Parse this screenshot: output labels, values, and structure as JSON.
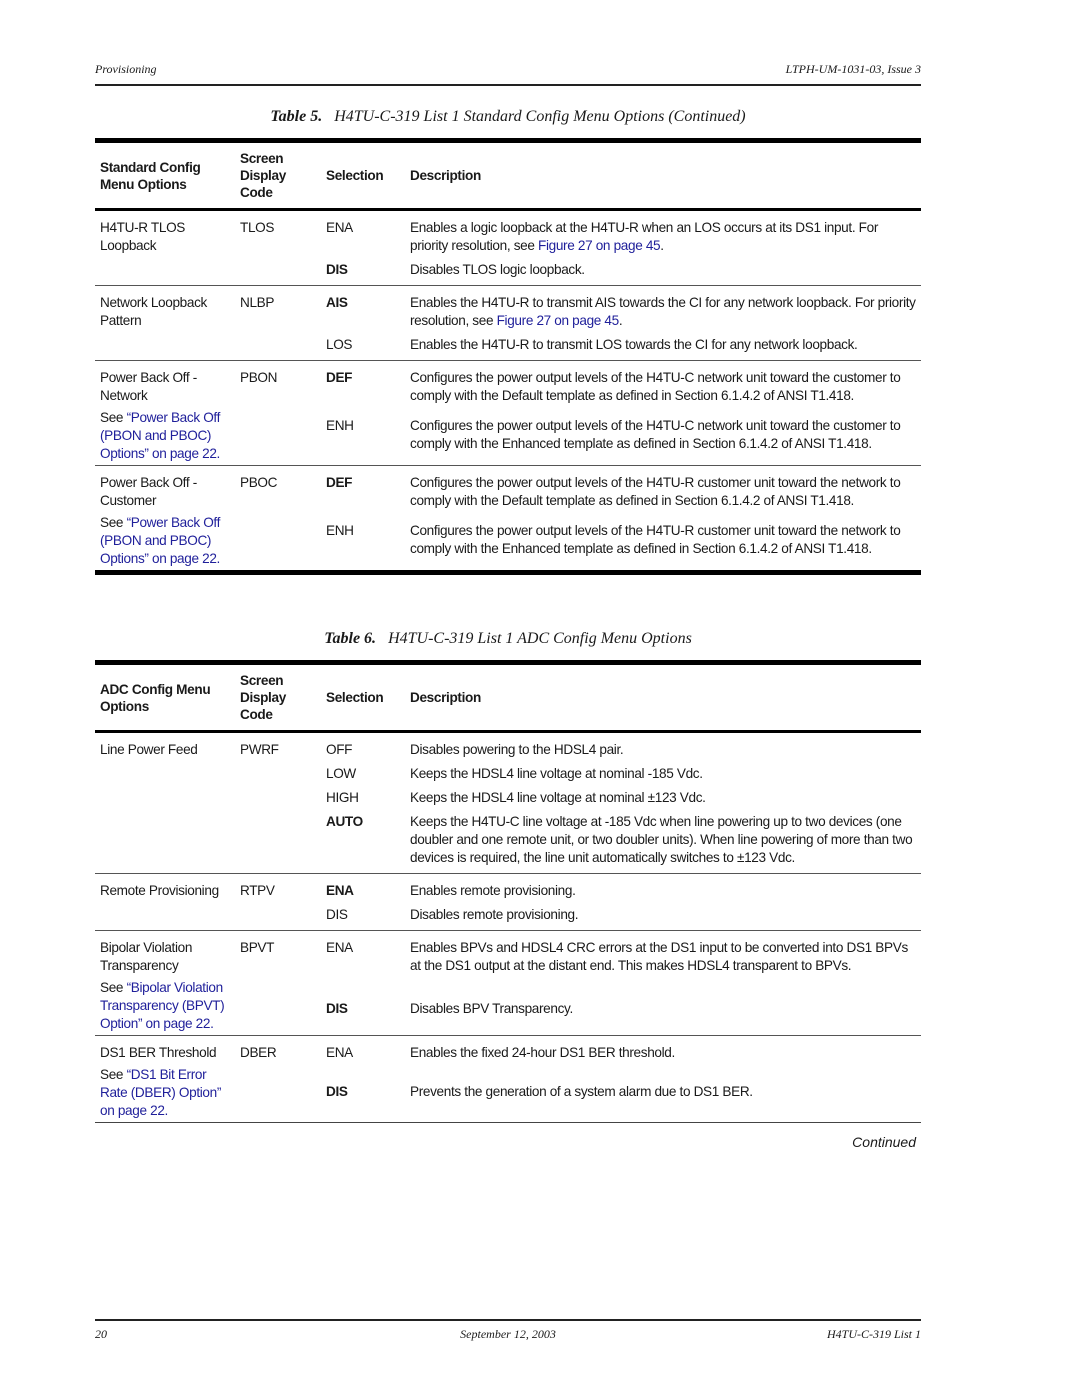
{
  "header": {
    "section": "Provisioning",
    "doc_id": "LTPH-UM-1031-03, Issue 3"
  },
  "table5": {
    "number": "Table 5.",
    "title": "H4TU-C-319 List 1 Standard Config Menu Options (Continued)",
    "columns": [
      "Standard Config Menu Options",
      "Screen Display Code",
      "Selection",
      "Description"
    ],
    "column_lines": [
      [
        "Standard Config",
        "Menu Options"
      ],
      [
        "Screen",
        "Display Code"
      ],
      [
        "Selection"
      ],
      [
        "Description"
      ]
    ],
    "groups": [
      {
        "option": "H4TU-R TLOS Loopback",
        "code": "TLOS",
        "rows": [
          {
            "selection": "ENA",
            "default": false,
            "description": "Enables a logic loopback at the H4TU-R when an LOS occurs at its DS1 input. For priority resolution, see ",
            "link": "Figure 27 on page 45",
            "after": "."
          },
          {
            "selection": "DIS",
            "default": true,
            "description": "Disables TLOS logic loopback."
          }
        ]
      },
      {
        "option": "Network Loopback Pattern",
        "code": "NLBP",
        "rows": [
          {
            "selection": "AIS",
            "default": true,
            "description": "Enables the H4TU-R to transmit AIS towards the CI for any network loopback. For priority resolution, see ",
            "link": "Figure 27 on page 45",
            "after": "."
          },
          {
            "selection": "LOS",
            "default": false,
            "description": "Enables the H4TU-R to transmit LOS towards the CI for any network loopback."
          }
        ]
      },
      {
        "option": "Power Back Off - Network",
        "code": "PBON",
        "see_prefix": "See ",
        "see_link": "“Power Back Off (PBON and PBOC) Options” on page 22.",
        "rows": [
          {
            "selection": "DEF",
            "default": true,
            "description": "Configures the power output levels of the H4TU-C network unit toward the customer to comply with the Default template as defined in Section 6.1.4.2 of ANSI T1.418."
          },
          {
            "selection": "ENH",
            "default": false,
            "description": "Configures the power output levels of the H4TU-C network unit toward the customer to comply with the Enhanced template as defined in Section 6.1.4.2 of ANSI T1.418."
          }
        ]
      },
      {
        "option": "Power Back Off - Customer",
        "code": "PBOC",
        "see_prefix": "See ",
        "see_link": "“Power Back Off (PBON and PBOC) Options” on page 22.",
        "rows": [
          {
            "selection": "DEF",
            "default": true,
            "description": "Configures the power output levels of the H4TU-R customer unit toward the network to comply with the Default template as defined in Section 6.1.4.2 of ANSI T1.418."
          },
          {
            "selection": "ENH",
            "default": false,
            "description": "Configures the power output levels of the H4TU-R customer unit toward the network to comply with the Enhanced template as defined in Section 6.1.4.2 of ANSI T1.418."
          }
        ]
      }
    ]
  },
  "table6": {
    "number": "Table 6.",
    "title": "H4TU-C-319 List 1 ADC Config Menu Options",
    "columns": [
      "ADC Config Menu Options",
      "Screen Display Code",
      "Selection",
      "Description"
    ],
    "column_lines": [
      [
        "ADC Config Menu",
        "Options"
      ],
      [
        "Screen",
        "Display Code"
      ],
      [
        "Selection"
      ],
      [
        "Description"
      ]
    ],
    "groups": [
      {
        "option": "Line Power Feed",
        "code": "PWRF",
        "rows": [
          {
            "selection": "OFF",
            "default": false,
            "description": "Disables powering to the HDSL4 pair."
          },
          {
            "selection": "LOW",
            "default": false,
            "description": "Keeps the HDSL4 line voltage at nominal -185 Vdc."
          },
          {
            "selection": "HIGH",
            "default": false,
            "description": "Keeps the HDSL4 line voltage at nominal ±123 Vdc."
          },
          {
            "selection": "AUTO",
            "default": true,
            "description": "Keeps the H4TU-C line voltage at -185 Vdc when line powering up to two devices (one doubler and one remote unit, or two doubler units). When line powering of more than two devices is required, the line unit automatically switches to ±123 Vdc."
          }
        ]
      },
      {
        "option": "Remote Provisioning",
        "code": "RTPV",
        "rows": [
          {
            "selection": "ENA",
            "default": true,
            "description": "Enables remote provisioning."
          },
          {
            "selection": "DIS",
            "default": false,
            "description": "Disables remote provisioning."
          }
        ]
      },
      {
        "option": "Bipolar Violation Transparency",
        "code": "BPVT",
        "see_prefix": "See ",
        "see_link": "“Bipolar Violation Transparency (BPVT) Option” on page 22.",
        "rows": [
          {
            "selection": "ENA",
            "default": false,
            "description": "Enables BPVs and HDSL4 CRC errors at the DS1 input to be converted into DS1 BPVs at the DS1 output at the distant end. This makes HDSL4 transparent to BPVs."
          },
          {
            "selection": "DIS",
            "default": true,
            "description": "Disables BPV Transparency."
          }
        ]
      },
      {
        "option": "DS1 BER Threshold",
        "code": "DBER",
        "see_prefix": "See ",
        "see_link": "“DS1 Bit Error Rate (DBER) Option” on page 22.",
        "rows": [
          {
            "selection": "ENA",
            "default": false,
            "description": "Enables the fixed 24-hour DS1 BER threshold."
          },
          {
            "selection": "DIS",
            "default": true,
            "description": "Prevents the generation of a system alarm due to DS1 BER."
          }
        ]
      }
    ]
  },
  "continued_label": "Continued",
  "footer": {
    "page_number": "20",
    "date": "September 12, 2003",
    "product": "H4TU-C-319 List 1"
  },
  "colors": {
    "link": "#1f1f9a",
    "text": "#1a1a1a",
    "rule": "#000000"
  }
}
